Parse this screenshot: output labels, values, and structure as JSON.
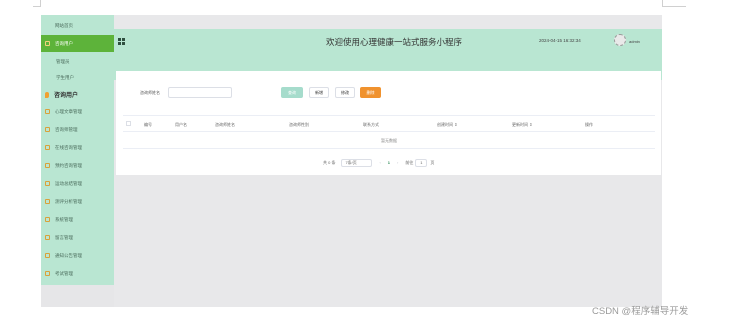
{
  "sidebar": {
    "items": [
      {
        "label": "网站首页"
      },
      {
        "label": "咨询用户"
      },
      {
        "label": "管理员"
      },
      {
        "label": "学生用户"
      },
      {
        "label": "咨询用户"
      },
      {
        "label": "心理文章管理"
      },
      {
        "label": "咨询师管理"
      },
      {
        "label": "在线咨询管理"
      },
      {
        "label": "预约咨询管理"
      },
      {
        "label": "运动总结管理"
      },
      {
        "label": "测评分析管理"
      },
      {
        "label": "系统管理"
      },
      {
        "label": "留言管理"
      },
      {
        "label": "通知公告管理"
      },
      {
        "label": "考试管理"
      }
    ]
  },
  "header": {
    "title": "欢迎使用心理健康一站式服务小程序",
    "datetime": "2024-04-15 16:32:34",
    "username": "admin"
  },
  "search": {
    "label": "咨询师姓名",
    "value": ""
  },
  "toolbar": {
    "query": "查询",
    "add": "新增",
    "edit": "修改",
    "delete": "删除"
  },
  "table": {
    "columns": [
      "编号",
      "用户名",
      "咨询师姓名",
      "咨询师性别",
      "联系方式",
      "创建时间 ⇕",
      "更新时间 ⇕",
      "操作"
    ],
    "empty_text": "暂无数据"
  },
  "pagination": {
    "total": "共 0 条",
    "page_size": "7条/页",
    "prev": "‹",
    "page": "1",
    "next": "›",
    "jump_label": "前往",
    "jump_value": "1",
    "jump_suffix": "页"
  },
  "watermark": "CSDN @程序辅导开发"
}
